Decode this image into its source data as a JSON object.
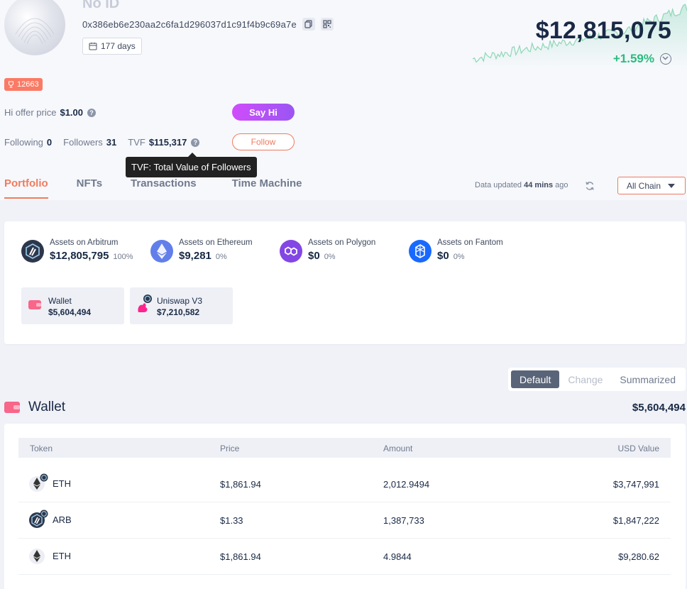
{
  "profile": {
    "name": "No ID",
    "address": "0x386eb6e230aa2c6fa1d296037d1c91f4b9c69a7e",
    "days": "177 days",
    "rank": "12663",
    "total_value": "$12,815,075",
    "change_pct": "+1.59%"
  },
  "social": {
    "hi_label": "Hi offer price",
    "hi_price": "$1.00",
    "say_hi_label": "Say Hi",
    "following_label": "Following",
    "following_count": "0",
    "followers_label": "Followers",
    "followers_count": "31",
    "tvf_label": "TVF",
    "tvf_value": "$115,317",
    "follow_label": "Follow",
    "tooltip": "TVF: Total Value of Followers"
  },
  "tabs": [
    {
      "label": "Portfolio",
      "active": true
    },
    {
      "label": "NFTs"
    },
    {
      "label": "Transactions"
    },
    {
      "label": "Time Machine"
    }
  ],
  "update": {
    "prefix": "Data updated",
    "time": "44 mins",
    "suffix": "ago"
  },
  "chain_filter": "All Chain",
  "chains": [
    {
      "label": "Assets on Arbitrum",
      "value": "$12,805,795",
      "pct": "100%",
      "color": "#2d374b"
    },
    {
      "label": "Assets on Ethereum",
      "value": "$9,281",
      "pct": "0%",
      "color": "#627eea"
    },
    {
      "label": "Assets on Polygon",
      "value": "$0",
      "pct": "0%",
      "color": "#8247e5"
    },
    {
      "label": "Assets on Fantom",
      "value": "$0",
      "pct": "0%",
      "color": "#1969ff"
    }
  ],
  "protocols": [
    {
      "name": "Wallet",
      "value": "$5,604,494"
    },
    {
      "name": "Uniswap V3",
      "value": "$7,210,582"
    }
  ],
  "view_options": [
    {
      "label": "Default",
      "active": true
    },
    {
      "label": "Change",
      "disabled": true
    },
    {
      "label": "Summarized"
    }
  ],
  "wallet": {
    "title": "Wallet",
    "total": "$5,604,494",
    "columns": [
      "Token",
      "Price",
      "Amount",
      "USD Value"
    ],
    "rows": [
      {
        "symbol": "ETH",
        "price": "$1,861.94",
        "amount": "2,012.9494",
        "usd": "$3,747,991",
        "icon": "eth-icon",
        "chain_badge": true
      },
      {
        "symbol": "ARB",
        "price": "$1.33",
        "amount": "1,387,733",
        "usd": "$1,847,222",
        "icon": "arb-icon",
        "chain_badge": true
      },
      {
        "symbol": "ETH",
        "price": "$1,861.94",
        "amount": "4.9844",
        "usd": "$9,280.62",
        "icon": "eth-icon",
        "chain_badge": false
      }
    ]
  },
  "colors": {
    "accent": "#f07b5e",
    "positive": "#2abb7f",
    "say_hi_gradient": [
      "#d04dfb",
      "#9a55f3"
    ],
    "text_primary": "#192945"
  }
}
